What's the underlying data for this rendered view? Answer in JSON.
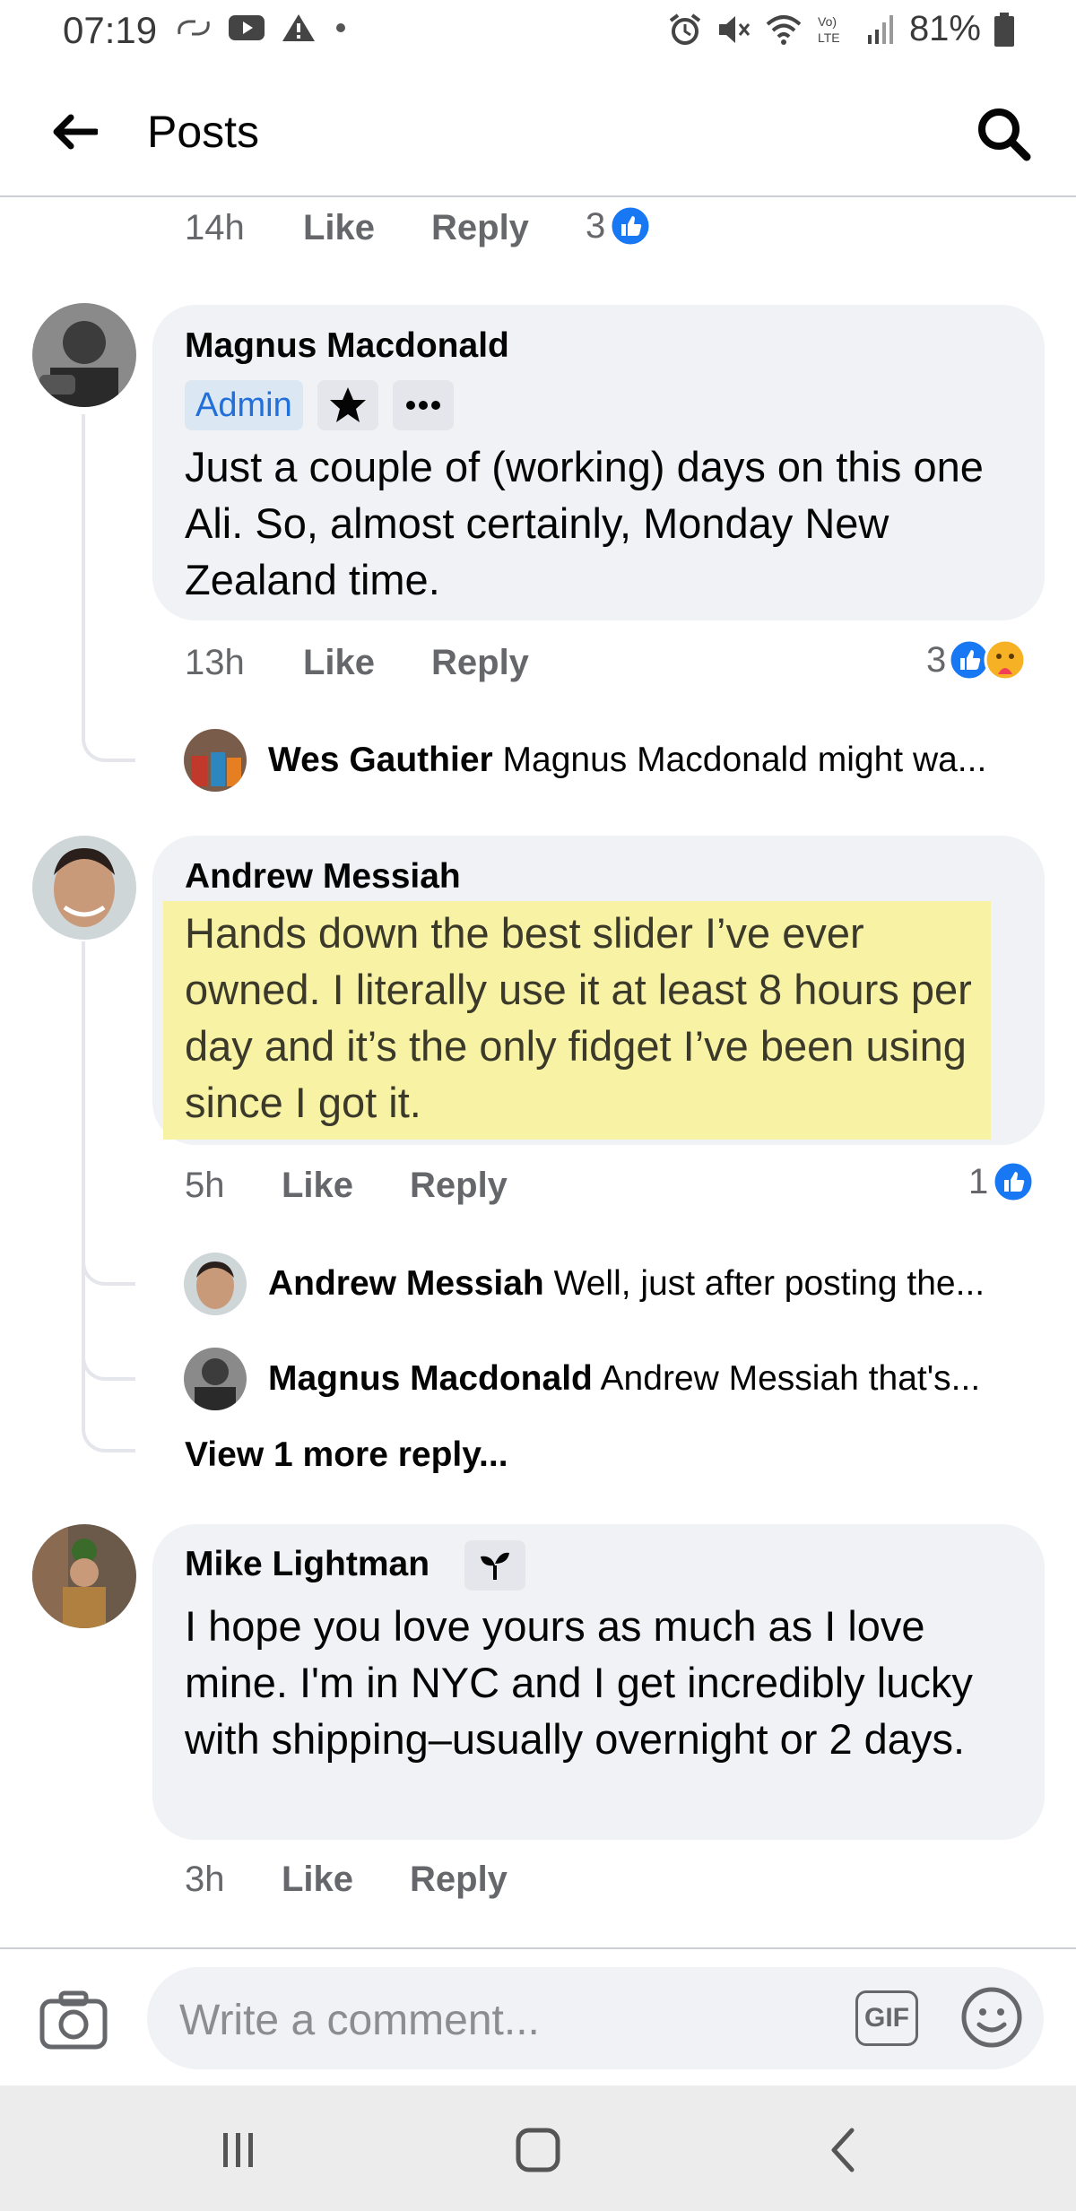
{
  "status_bar": {
    "time": "07:19",
    "battery": "81%"
  },
  "header": {
    "title": "Posts"
  },
  "prev_comment_actions": {
    "time": "14h",
    "like": "Like",
    "reply": "Reply",
    "reactions": "3"
  },
  "comments": [
    {
      "author": "Magnus Macdonald",
      "badge": "Admin",
      "text": "Just a couple of (working) days on this one Ali. So, almost certainly, Monday New Zealand time.",
      "time": "13h",
      "like": "Like",
      "reply": "Reply",
      "reactions": "3",
      "replies": [
        {
          "author": "Wes Gauthier",
          "text": "Magnus Macdonald might wa..."
        }
      ]
    },
    {
      "author": "Andrew Messiah",
      "text": "Hands down the best slider I’ve ever owned.  I literally use it at least 8 hours per day and it’s the only fidget I’ve been using since I got it.",
      "time": "5h",
      "like": "Like",
      "reply": "Reply",
      "reactions": "1",
      "replies": [
        {
          "author": "Andrew Messiah",
          "text": "Well, just after posting the..."
        },
        {
          "author": "Magnus Macdonald",
          "text": "Andrew Messiah that's..."
        }
      ],
      "view_more": "View 1 more reply..."
    },
    {
      "author": "Mike Lightman",
      "text": "I hope you love yours as much as I love mine. I'm in NYC and I get incredibly lucky with shipping–usually overnight or 2 days.",
      "time": "3h",
      "like": "Like",
      "reply": "Reply"
    }
  ],
  "composer": {
    "placeholder": "Write a comment...",
    "gif_label": "GIF"
  },
  "colors": {
    "like_blue": "#1877f2",
    "highlight": "#f8f2a5",
    "bubble": "#f0f2f5"
  }
}
